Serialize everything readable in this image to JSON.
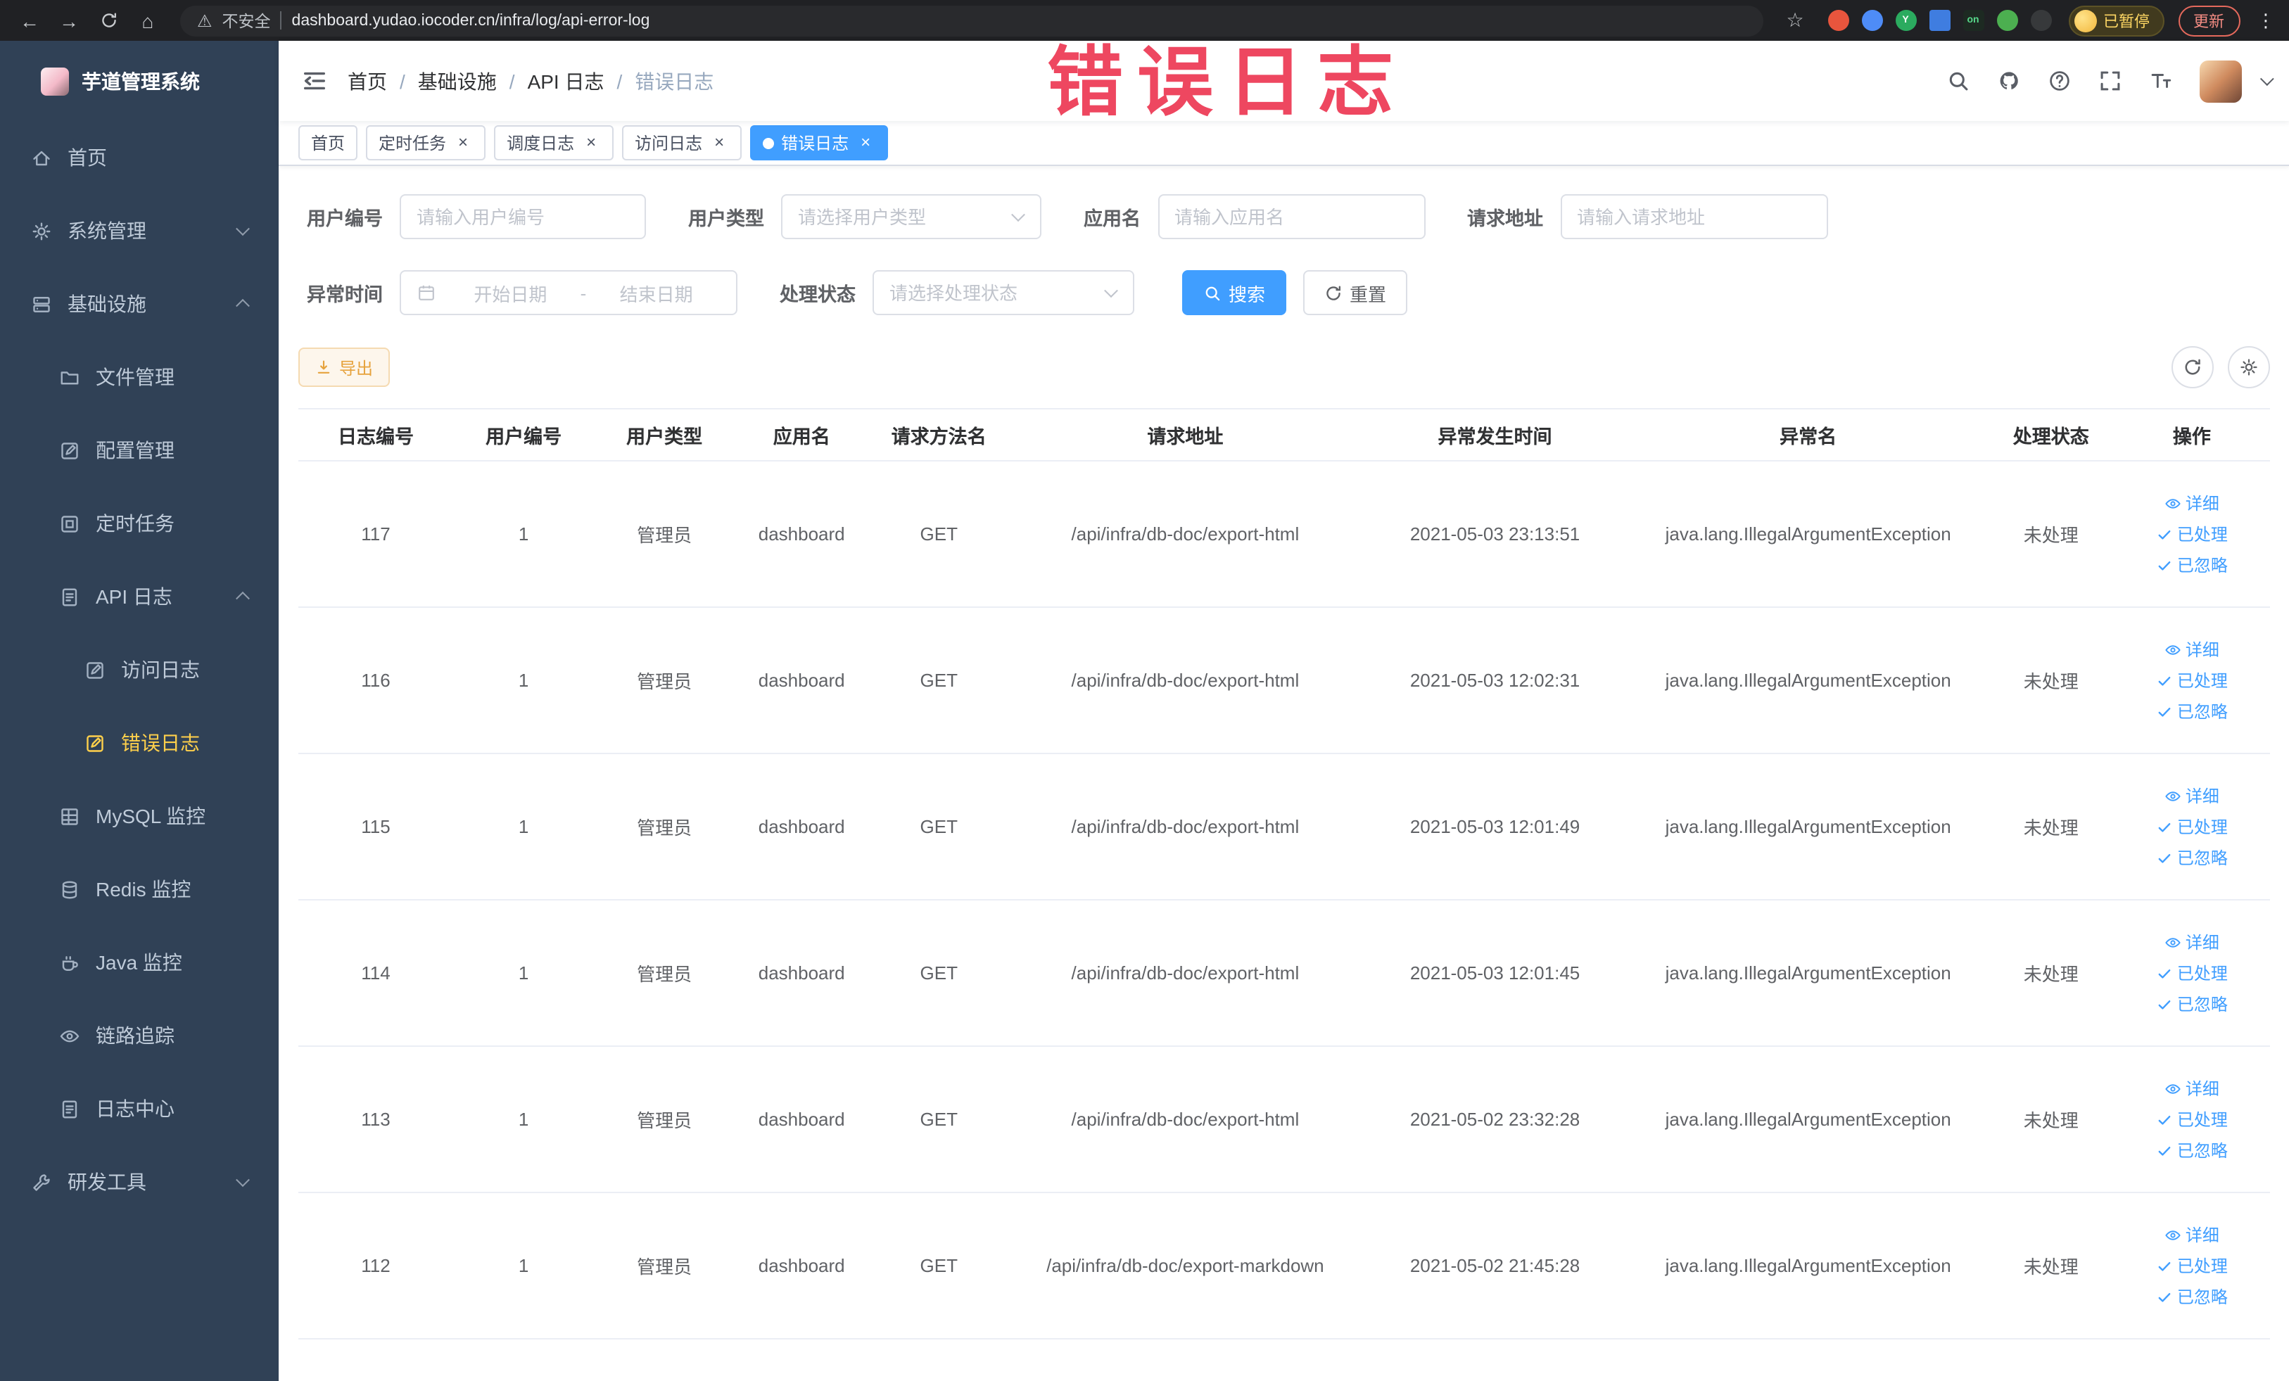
{
  "theme": {
    "primary": "#409eff",
    "sidebar_bg": "#304156",
    "sidebar_active_text": "#ffd04b",
    "warning": "#e6a23c",
    "annotation_color": "#ee4760"
  },
  "browser": {
    "security_label": "不安全",
    "url": "dashboard.yudao.iocoder.cn/infra/log/api-error-log",
    "paused_badge": "已暂停",
    "update_button": "更新",
    "extensions": [
      {
        "key": "extension-1",
        "color": "#e8553d",
        "shape": "circle",
        "glyph": ""
      },
      {
        "key": "extension-2",
        "color": "#4e8cf7",
        "shape": "circle",
        "glyph": ""
      },
      {
        "key": "extension-3",
        "color": "#2bab5f",
        "shape": "circle",
        "glyph": "Y"
      },
      {
        "key": "extension-4",
        "color": "#3f7de0",
        "shape": "grid",
        "glyph": ""
      },
      {
        "key": "extension-5",
        "color": "#1d2a22",
        "shape": "square",
        "glyph": "on",
        "glyph_color": "#57d98a"
      },
      {
        "key": "extension-6",
        "color": "#4caf50",
        "shape": "circle",
        "glyph": ""
      },
      {
        "key": "extension-7",
        "color": "#37393b",
        "shape": "circle",
        "glyph": ""
      }
    ]
  },
  "annotation": {
    "text": "错误日志"
  },
  "sidebar": {
    "title": "芋道管理系统",
    "items": [
      {
        "key": "home",
        "label": "首页",
        "icon": "home",
        "level": 0
      },
      {
        "key": "system",
        "label": "系统管理",
        "icon": "gear",
        "level": 0,
        "chevron": "down"
      },
      {
        "key": "infra",
        "label": "基础设施",
        "icon": "server",
        "level": 0,
        "chevron": "up"
      },
      {
        "key": "file",
        "label": "文件管理",
        "icon": "folder",
        "level": 1
      },
      {
        "key": "config",
        "label": "配置管理",
        "icon": "edit",
        "level": 1
      },
      {
        "key": "job",
        "label": "定时任务",
        "icon": "box",
        "level": 1
      },
      {
        "key": "api-log",
        "label": "API 日志",
        "icon": "log",
        "level": 1,
        "chevron": "up"
      },
      {
        "key": "access-log",
        "label": "访问日志",
        "icon": "edit",
        "level": 2
      },
      {
        "key": "error-log",
        "label": "错误日志",
        "icon": "edit",
        "level": 2,
        "active": true
      },
      {
        "key": "mysql",
        "label": "MySQL 监控",
        "icon": "grid",
        "level": 1
      },
      {
        "key": "redis",
        "label": "Redis 监控",
        "icon": "db",
        "level": 1
      },
      {
        "key": "java",
        "label": "Java 监控",
        "icon": "coffee",
        "level": 1
      },
      {
        "key": "trace",
        "label": "链路追踪",
        "icon": "eye",
        "level": 1
      },
      {
        "key": "log-center",
        "label": "日志中心",
        "icon": "log",
        "level": 1
      },
      {
        "key": "dev-tools",
        "label": "研发工具",
        "icon": "tool",
        "level": 0,
        "chevron": "down"
      }
    ]
  },
  "header": {
    "breadcrumb": [
      "首页",
      "基础设施",
      "API 日志",
      "错误日志"
    ],
    "breadcrumb_separator": "/"
  },
  "tabs": [
    {
      "key": "home",
      "label": "首页",
      "closable": false,
      "active": false
    },
    {
      "key": "job",
      "label": "定时任务",
      "closable": true,
      "active": false
    },
    {
      "key": "job-log",
      "label": "调度日志",
      "closable": true,
      "active": false
    },
    {
      "key": "api-access-log",
      "label": "访问日志",
      "closable": true,
      "active": false
    },
    {
      "key": "api-error-log",
      "label": "错误日志",
      "closable": true,
      "active": true
    }
  ],
  "filters": {
    "user_id": {
      "label": "用户编号",
      "placeholder": "请输入用户编号"
    },
    "user_type": {
      "label": "用户类型",
      "placeholder": "请选择用户类型"
    },
    "app_name": {
      "label": "应用名",
      "placeholder": "请输入应用名"
    },
    "request_url": {
      "label": "请求地址",
      "placeholder": "请输入请求地址"
    },
    "exception_time": {
      "label": "异常时间",
      "start_placeholder": "开始日期",
      "end_placeholder": "结束日期",
      "separator": "-"
    },
    "process_status": {
      "label": "处理状态",
      "placeholder": "请选择处理状态"
    },
    "search_button": "搜索",
    "reset_button": "重置"
  },
  "toolbar": {
    "export_button": "导出"
  },
  "table": {
    "columns": [
      "日志编号",
      "用户编号",
      "用户类型",
      "应用名",
      "请求方法名",
      "请求地址",
      "异常发生时间",
      "异常名",
      "处理状态",
      "操作"
    ],
    "actions": [
      {
        "key": "detail",
        "label": "详细",
        "icon": "eye"
      },
      {
        "key": "processed",
        "label": "已处理",
        "icon": "check"
      },
      {
        "key": "ignored",
        "label": "已忽略",
        "icon": "check"
      }
    ],
    "rows": [
      {
        "id": "117",
        "user_id": "1",
        "user_type": "管理员",
        "app": "dashboard",
        "method": "GET",
        "url": "/api/infra/db-doc/export-html",
        "time": "2021-05-03 23:13:51",
        "exception": "java.lang.IllegalArgumentException",
        "status": "未处理"
      },
      {
        "id": "116",
        "user_id": "1",
        "user_type": "管理员",
        "app": "dashboard",
        "method": "GET",
        "url": "/api/infra/db-doc/export-html",
        "time": "2021-05-03 12:02:31",
        "exception": "java.lang.IllegalArgumentException",
        "status": "未处理"
      },
      {
        "id": "115",
        "user_id": "1",
        "user_type": "管理员",
        "app": "dashboard",
        "method": "GET",
        "url": "/api/infra/db-doc/export-html",
        "time": "2021-05-03 12:01:49",
        "exception": "java.lang.IllegalArgumentException",
        "status": "未处理"
      },
      {
        "id": "114",
        "user_id": "1",
        "user_type": "管理员",
        "app": "dashboard",
        "method": "GET",
        "url": "/api/infra/db-doc/export-html",
        "time": "2021-05-03 12:01:45",
        "exception": "java.lang.IllegalArgumentException",
        "status": "未处理"
      },
      {
        "id": "113",
        "user_id": "1",
        "user_type": "管理员",
        "app": "dashboard",
        "method": "GET",
        "url": "/api/infra/db-doc/export-html",
        "time": "2021-05-02 23:32:28",
        "exception": "java.lang.IllegalArgumentException",
        "status": "未处理"
      },
      {
        "id": "112",
        "user_id": "1",
        "user_type": "管理员",
        "app": "dashboard",
        "method": "GET",
        "url": "/api/infra/db-doc/export-markdown",
        "time": "2021-05-02 21:45:28",
        "exception": "java.lang.IllegalArgumentException",
        "status": "未处理"
      }
    ]
  }
}
